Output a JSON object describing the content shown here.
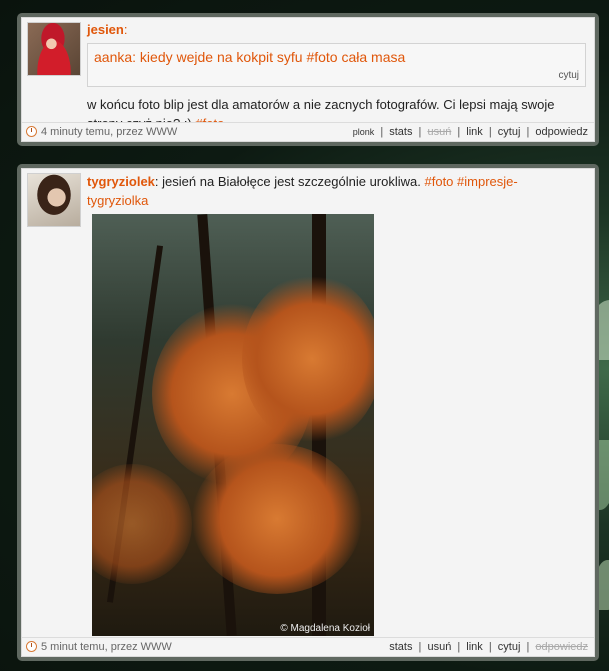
{
  "posts": [
    {
      "author": "jesien",
      "author_suffix": ":",
      "quote": {
        "text": "aanka: kiedy wejde na kokpit syfu #foto cała masa",
        "cite_label": "cytuj"
      },
      "message": "w końcu foto blip jest dla amatorów a nie zacnych fotografów. Ci lepsi mają swoje strony czyż nie? :)",
      "message_tag": "#foto",
      "timeago": "4 minuty temu, przez WWW",
      "actions": {
        "plonk": "plonk",
        "stats": "stats",
        "delete": "usuń",
        "link": "link",
        "quote": "cytuj",
        "reply": "odpowiedz"
      }
    },
    {
      "author": "tygryziolek",
      "author_suffix": ":",
      "message": "jesień na Białołęce jest szczególnie urokliwa.",
      "tag1": "#foto",
      "tag2": "#impresje-tygryziolka",
      "photo_credit": "© Magdalena Kozioł",
      "timeago": "5 minut temu, przez WWW",
      "actions": {
        "stats": "stats",
        "delete": "usuń",
        "link": "link",
        "quote": "cytuj",
        "reply": "odpowiedz"
      }
    }
  ],
  "separator": "|"
}
